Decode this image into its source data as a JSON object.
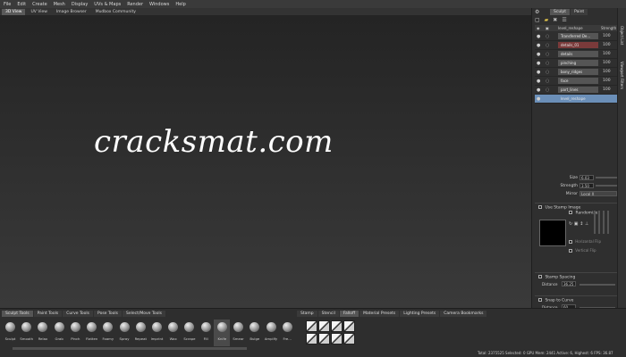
{
  "menu": [
    "File",
    "Edit",
    "Create",
    "Mesh",
    "Display",
    "UVs & Maps",
    "Render",
    "Windows",
    "Help"
  ],
  "view_tabs": [
    {
      "label": "3D View",
      "active": true
    },
    {
      "label": "UV View",
      "active": false
    },
    {
      "label": "Image Browser",
      "active": false
    },
    {
      "label": "Mudbox Community",
      "active": false
    }
  ],
  "watermark": "cracksmat.com",
  "right_panel": {
    "tabs": [
      {
        "label": "Sculpt",
        "active": true
      },
      {
        "label": "Paint",
        "active": false
      }
    ],
    "layer_header": {
      "name": "level_reshape",
      "strength": "Strength"
    },
    "layers": [
      {
        "name": "Transferred De...",
        "value": "100",
        "selected": false
      },
      {
        "name": "details_01",
        "value": "100",
        "selected": false
      },
      {
        "name": "details",
        "value": "100",
        "selected": false
      },
      {
        "name": "pinching",
        "value": "100",
        "selected": false
      },
      {
        "name": "bony_ridges",
        "value": "100",
        "selected": false
      },
      {
        "name": "face",
        "value": "100",
        "selected": false
      },
      {
        "name": "part_lines",
        "value": "100",
        "selected": false
      },
      {
        "name": "level_reshape",
        "value": "",
        "selected": true
      }
    ],
    "properties": {
      "size_label": "Size",
      "size_value": "6.03",
      "strength_label": "Strength",
      "strength_value": "3.50",
      "mirror_label": "Mirror",
      "mirror_value": "Local X"
    },
    "stamp": {
      "use_stamp_label": "Use Stamp Image",
      "randomize_label": "Randomize",
      "horizontal_flip": "Horizontal Flip",
      "vertical_flip": "Vertical Flip"
    },
    "stamp_spacing": {
      "label": "Stamp Spacing",
      "distance_label": "Distance",
      "distance_value": "36.25"
    },
    "snap_to_curve": {
      "label": "Snap to Curve",
      "distance_label": "Distance",
      "distance_value": "60"
    }
  },
  "side_strip": [
    "Object List",
    "Viewport Filters"
  ],
  "bottom": {
    "tabs": [
      {
        "label": "Sculpt Tools",
        "active": true
      },
      {
        "label": "Paint Tools",
        "active": false
      },
      {
        "label": "Curve Tools",
        "active": false
      },
      {
        "label": "Pose Tools",
        "active": false
      },
      {
        "label": "Select/Move Tools",
        "active": false
      }
    ],
    "tools": [
      {
        "label": "Sculpt",
        "active": false
      },
      {
        "label": "Smooth",
        "active": false
      },
      {
        "label": "Relax",
        "active": false
      },
      {
        "label": "Grab",
        "active": false
      },
      {
        "label": "Pinch",
        "active": false
      },
      {
        "label": "Flatten",
        "active": false
      },
      {
        "label": "Foamy",
        "active": false
      },
      {
        "label": "Spray",
        "active": false
      },
      {
        "label": "Repeat",
        "active": false
      },
      {
        "label": "Imprint",
        "active": false
      },
      {
        "label": "Wax",
        "active": false
      },
      {
        "label": "Scrape",
        "active": false
      },
      {
        "label": "Fill",
        "active": false
      },
      {
        "label": "Knife",
        "active": true
      },
      {
        "label": "Smear",
        "active": false
      },
      {
        "label": "Bulge",
        "active": false
      },
      {
        "label": "Amplify",
        "active": false
      },
      {
        "label": "Fre...",
        "active": false
      }
    ],
    "stamp_tabs": [
      {
        "label": "Stamp",
        "active": false
      },
      {
        "label": "Stencil",
        "active": false
      },
      {
        "label": "Falloff",
        "active": true
      },
      {
        "label": "Material Presets",
        "active": false
      },
      {
        "label": "Lighting Presets",
        "active": false
      },
      {
        "label": "Camera Bookmarks",
        "active": false
      }
    ],
    "status": "Total: 2375525  Selected: 0  GPU Mem: 2441  Active: 6, Highest: 6  FPS: 36.87"
  }
}
